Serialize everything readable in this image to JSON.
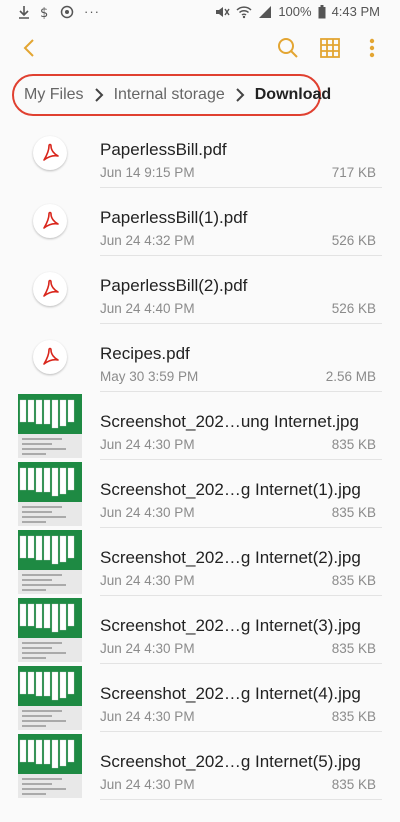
{
  "status_bar": {
    "battery": "100%",
    "time": "4:43 PM"
  },
  "colors": {
    "accent": "#e3a532",
    "highlight": "#e04030",
    "pdf_red": "#d9261c",
    "thumb_green": "#1e8a43"
  },
  "breadcrumb": {
    "items": [
      "My Files",
      "Internal storage",
      "Download"
    ]
  },
  "files": [
    {
      "name": "PaperlessBill.pdf",
      "date": "Jun 14 9:15 PM",
      "size": "717 KB",
      "type": "pdf"
    },
    {
      "name": "PaperlessBill(1).pdf",
      "date": "Jun 24 4:32 PM",
      "size": "526 KB",
      "type": "pdf"
    },
    {
      "name": "PaperlessBill(2).pdf",
      "date": "Jun 24 4:40 PM",
      "size": "526 KB",
      "type": "pdf"
    },
    {
      "name": "Recipes.pdf",
      "date": "May 30 3:59 PM",
      "size": "2.56 MB",
      "type": "pdf"
    },
    {
      "name": "Screenshot_202…ung Internet.jpg",
      "date": "Jun 24 4:30 PM",
      "size": "835 KB",
      "type": "image"
    },
    {
      "name": "Screenshot_202…g Internet(1).jpg",
      "date": "Jun 24 4:30 PM",
      "size": "835 KB",
      "type": "image"
    },
    {
      "name": "Screenshot_202…g Internet(2).jpg",
      "date": "Jun 24 4:30 PM",
      "size": "835 KB",
      "type": "image"
    },
    {
      "name": "Screenshot_202…g Internet(3).jpg",
      "date": "Jun 24 4:30 PM",
      "size": "835 KB",
      "type": "image"
    },
    {
      "name": "Screenshot_202…g Internet(4).jpg",
      "date": "Jun 24 4:30 PM",
      "size": "835 KB",
      "type": "image"
    },
    {
      "name": "Screenshot_202…g Internet(5).jpg",
      "date": "Jun 24 4:30 PM",
      "size": "835 KB",
      "type": "image"
    }
  ]
}
